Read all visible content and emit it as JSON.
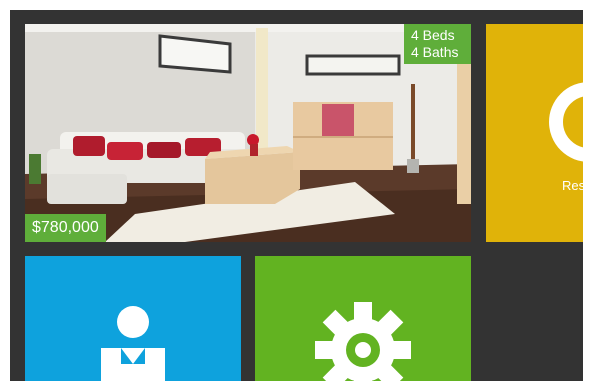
{
  "listing": {
    "beds": "4 Beds",
    "baths": "4 Baths",
    "price": "$780,000"
  },
  "tiles": {
    "yellow": {
      "label": "Res",
      "icon": "ring-icon",
      "color": "#e0b309"
    },
    "blue": {
      "icon": "person-icon",
      "color": "#0ea2dd"
    },
    "green": {
      "icon": "gear-icon",
      "color": "#62b321"
    }
  },
  "colors": {
    "background": "#333333",
    "badge": "#5fae3a"
  }
}
